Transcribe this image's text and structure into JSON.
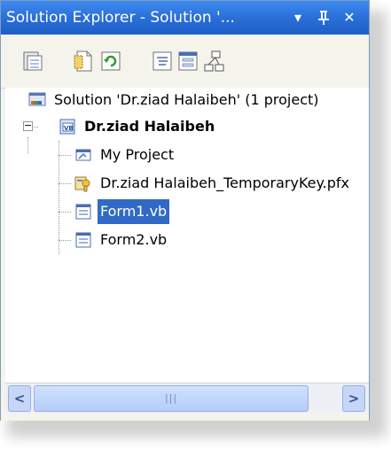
{
  "window": {
    "title": "Solution Explorer - Solution '...",
    "title_buttons": {
      "dropdown": "▾",
      "pin": "Ⅱ",
      "close": "✕"
    }
  },
  "toolbar": {
    "buttons": [
      {
        "name": "properties",
        "icon": "properties-icon"
      },
      {
        "name": "show-all-files",
        "icon": "show-all-files-icon"
      },
      {
        "name": "refresh",
        "icon": "refresh-icon"
      },
      {
        "name": "view-code",
        "icon": "view-code-icon"
      },
      {
        "name": "view-designer",
        "icon": "view-designer-icon"
      },
      {
        "name": "view-class-diagram",
        "icon": "class-diagram-icon"
      }
    ]
  },
  "tree": {
    "solution": {
      "label": "Solution 'Dr.ziad Halaibeh' (1 project)",
      "icon": "solution-icon"
    },
    "project": {
      "label": "Dr.ziad Halaibeh",
      "icon": "vb-project-icon",
      "expander": "−"
    },
    "children": [
      {
        "label": "My Project",
        "icon": "my-project-icon",
        "selected": false
      },
      {
        "label": "Dr.ziad Halaibeh_TemporaryKey.pfx",
        "icon": "key-icon",
        "selected": false
      },
      {
        "label": "Form1.vb",
        "icon": "form-icon",
        "selected": true
      },
      {
        "label": "Form2.vb",
        "icon": "form-icon",
        "selected": false
      }
    ]
  },
  "scrollbar": {
    "left_arrow": "<",
    "right_arrow": ">",
    "grip": "|||"
  },
  "colors": {
    "titlebar": "#2a6fd8",
    "selection": "#316ac5",
    "panel": "#f5f4ec"
  }
}
